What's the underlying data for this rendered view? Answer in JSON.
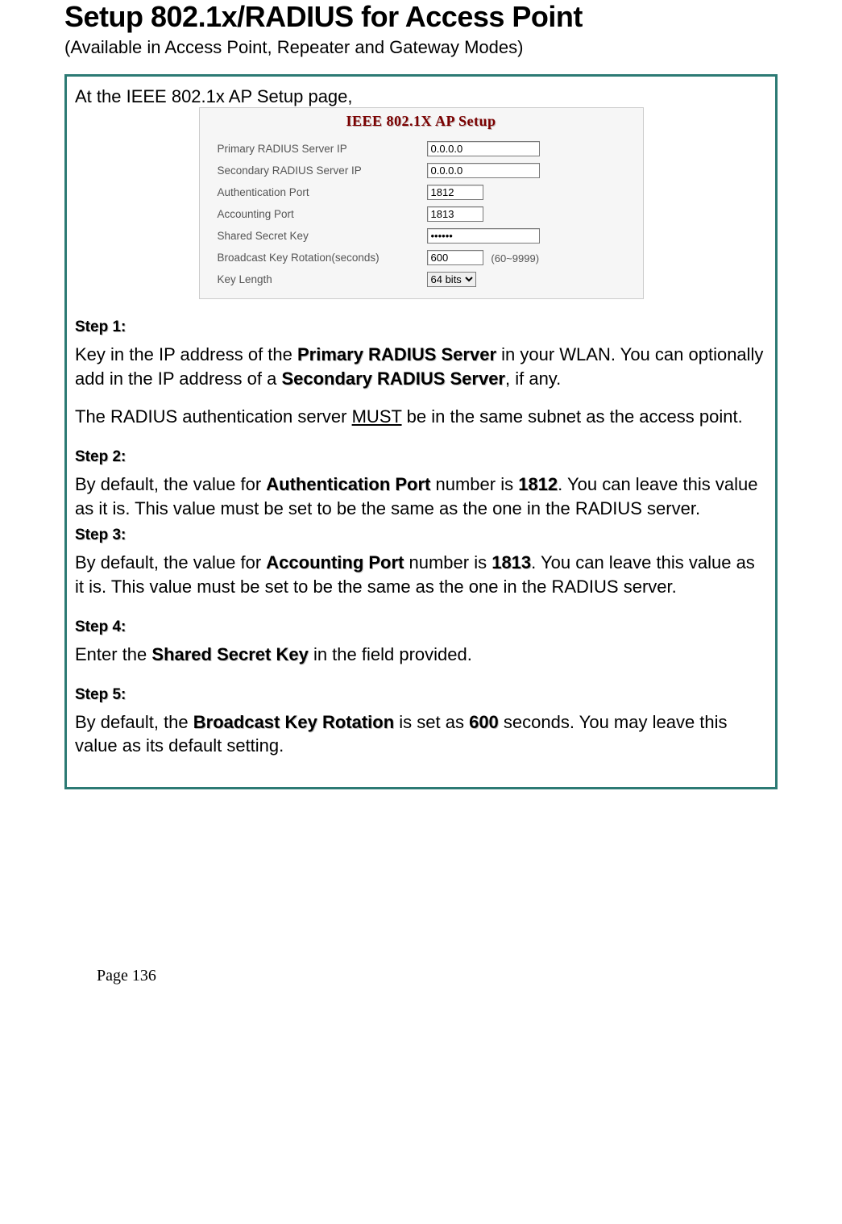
{
  "title": "Setup 802.1x/RADIUS for Access Point",
  "subtitle": "(Available in Access Point, Repeater and Gateway Modes)",
  "intro": "At the IEEE 802.1x AP Setup page,",
  "ap_setup": {
    "title": "IEEE 802.1X AP Setup",
    "fields": {
      "primary_label": "Primary RADIUS Server IP",
      "primary_value": "0.0.0.0",
      "secondary_label": "Secondary RADIUS Server IP",
      "secondary_value": "0.0.0.0",
      "auth_port_label": "Authentication Port",
      "auth_port_value": "1812",
      "acct_port_label": "Accounting Port",
      "acct_port_value": "1813",
      "secret_label": "Shared Secret Key",
      "secret_value": "••••••",
      "rotation_label": "Broadcast Key Rotation(seconds)",
      "rotation_value": "600",
      "rotation_note": "(60~9999)",
      "keylen_label": "Key Length",
      "keylen_value": "64 bits"
    }
  },
  "steps": {
    "s1_label": "Step 1:",
    "s1_pre": "Key in the IP address of the ",
    "s1_b1": "Primary RADIUS Server",
    "s1_mid": " in your WLAN. You can optionally add in the IP address of a ",
    "s1_b2": "Secondary RADIUS Server",
    "s1_post": ", if any.",
    "s1_note_pre": "The RADIUS authentication server ",
    "s1_note_must": "MUST",
    "s1_note_post": " be in the same subnet as the access point.",
    "s2_label": "Step 2:",
    "s2_pre": "By default, the value for ",
    "s2_b1": "Authentication Port",
    "s2_mid": " number is ",
    "s2_b2": "1812",
    "s2_post": ". You can leave this value as it is. This value must be set to be the same as the one in the RADIUS server.",
    "s3_label": "Step 3:",
    "s3_pre": "By default, the value for ",
    "s3_b1": "Accounting Port",
    "s3_mid": " number is ",
    "s3_b2": "1813",
    "s3_post": ". You can leave this value as it is. This value must be set to be the same as the one in the RADIUS server.",
    "s4_label": "Step 4:",
    "s4_pre": "Enter the ",
    "s4_b1": "Shared Secret Key",
    "s4_post": " in the field provided.",
    "s5_label": "Step 5:",
    "s5_pre": "By default, the ",
    "s5_b1": "Broadcast Key Rotation",
    "s5_mid": " is set as ",
    "s5_b2": "600",
    "s5_post": " seconds. You may leave this value as its default setting."
  },
  "footer": "Page 136"
}
